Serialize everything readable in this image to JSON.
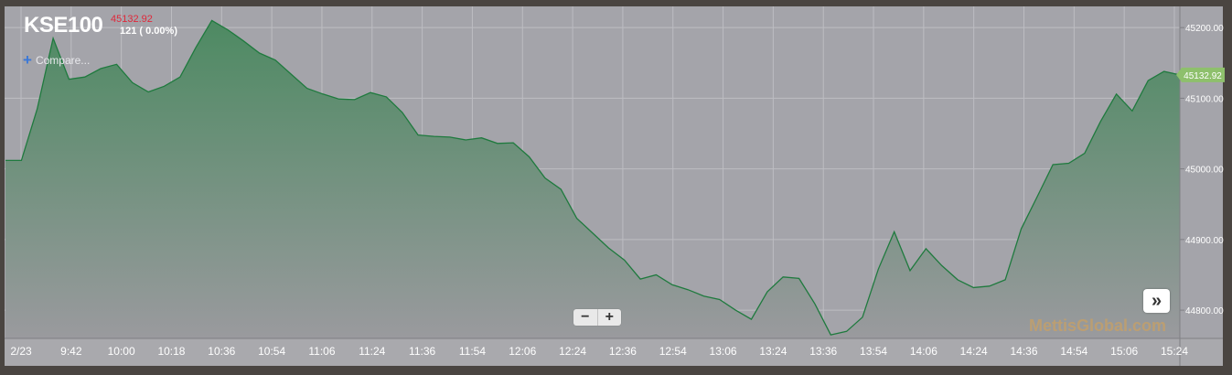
{
  "header": {
    "symbol": "KSE100",
    "last_price": "45132.92",
    "change": "121 ( 0.00%)",
    "compare_label": "Compare..."
  },
  "controls": {
    "zoom_out": "−",
    "zoom_in": "+",
    "scroll_end": "»"
  },
  "watermark": "MettisGlobal.com",
  "colors": {
    "background": "#a4a4aa",
    "line": "#1f7a3e",
    "area_top": "#4d8a62",
    "price_label": "#8ec06c",
    "down": "#e0283a"
  },
  "chart_data": {
    "type": "area",
    "title": "KSE100",
    "ylim": [
      44760,
      45230
    ],
    "yticks": [
      44800,
      44900,
      45000,
      45100,
      45200
    ],
    "ytick_labels": [
      "44800.00",
      "44900.00",
      "45000.00",
      "45100.00",
      "45200.00"
    ],
    "xtick_labels": [
      "2/23",
      "9:42",
      "10:00",
      "10:18",
      "10:36",
      "10:54",
      "11:06",
      "11:24",
      "11:36",
      "11:54",
      "12:06",
      "12:24",
      "12:36",
      "12:54",
      "13:06",
      "13:24",
      "13:36",
      "13:54",
      "14:06",
      "14:24",
      "14:36",
      "14:54",
      "15:06",
      "15:24"
    ],
    "last_value_label": "45132.92",
    "grid": true,
    "series": [
      {
        "values": [
          45012,
          45012,
          45085,
          45185,
          45127,
          45130,
          45142,
          45148,
          45122,
          45109,
          45117,
          45130,
          45172,
          45210,
          45197,
          45181,
          45164,
          45154,
          45134,
          45114,
          45106,
          45099,
          45098,
          45108,
          45102,
          45080,
          45048,
          45046,
          45045,
          45041,
          45044,
          45036,
          45037,
          45017,
          44987,
          44971,
          44930,
          44909,
          44888,
          44871,
          44844,
          44850,
          44836,
          44829,
          44820,
          44815,
          44800,
          44787,
          44826,
          44847,
          44845,
          44809,
          44765,
          44770,
          44790,
          44858,
          44911,
          44856,
          44887,
          44863,
          44843,
          44832,
          44834,
          44843,
          44915,
          44960,
          45006,
          45008,
          45022,
          45067,
          45106,
          45082,
          45125,
          45138,
          45133
        ]
      }
    ]
  }
}
